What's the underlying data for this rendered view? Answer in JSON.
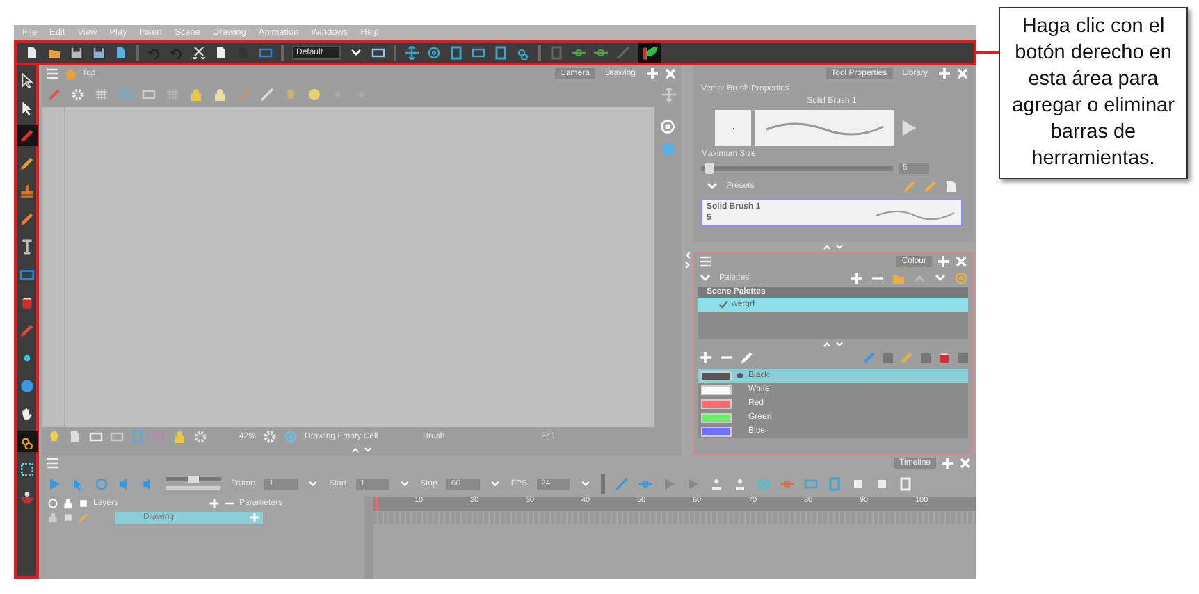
{
  "menu": [
    "File",
    "Edit",
    "View",
    "Play",
    "Insert",
    "Scene",
    "Drawing",
    "Animation",
    "Windows",
    "Help"
  ],
  "toolbar": {
    "preset_dropdown": "Default"
  },
  "tools": [
    {
      "selected": false
    },
    {
      "selected": false
    },
    {
      "selected": true
    },
    {
      "selected": false
    },
    {
      "selected": false
    },
    {
      "selected": false
    },
    {
      "selected": false
    },
    {
      "selected": false
    },
    {
      "selected": false
    },
    {
      "selected": false
    },
    {
      "selected": false
    },
    {
      "selected": false
    },
    {
      "selected": false
    },
    {
      "selected": true
    },
    {
      "selected": false
    },
    {
      "selected": false
    }
  ],
  "camera_view": {
    "breadcrumb": "Top",
    "tabs": [
      {
        "label": "Camera",
        "selected": true
      },
      {
        "label": "Drawing",
        "selected": false
      }
    ],
    "status": {
      "zoom": "42%",
      "cell": "Drawing Empty Cell",
      "tool": "Brush",
      "frame": "Fr 1"
    }
  },
  "tool_properties": {
    "tabs": [
      {
        "label": "Tool Properties",
        "selected": true
      },
      {
        "label": "Library",
        "selected": false
      }
    ],
    "title": "Vector Brush Properties",
    "brush_name": "Solid Brush 1",
    "max_size_label": "Maximum Size",
    "max_size": {
      "level": 0.02,
      "value": "5"
    },
    "presets_label": "Presets",
    "presets": [
      {
        "name": "Solid Brush 1",
        "size": "5",
        "selected": true
      }
    ]
  },
  "colour": {
    "tab": "Colour",
    "palettes_label": "Palettes",
    "palette_list_title": "Scene Palettes",
    "palettes": [
      {
        "name": "wergrf",
        "selected": true,
        "checked": true
      }
    ],
    "colours": [
      {
        "name": "Black",
        "color": "#555555",
        "selected": true
      },
      {
        "name": "White",
        "color": "#ffffff",
        "selected": false
      },
      {
        "name": "Red",
        "color": "#ff6b6b",
        "selected": false
      },
      {
        "name": "Green",
        "color": "#66ee66",
        "selected": false
      },
      {
        "name": "Blue",
        "color": "#7070ff",
        "selected": false
      }
    ]
  },
  "timeline": {
    "tab": "Timeline",
    "speed": {
      "level": 0.5
    },
    "fields": [
      {
        "label": "Frame",
        "value": "1"
      },
      {
        "label": "Start",
        "value": "1"
      },
      {
        "label": "Stop",
        "value": "60"
      },
      {
        "label": "FPS",
        "value": "24"
      }
    ],
    "layers_label": "Layers",
    "parameters_label": "Parameters",
    "ruler": [
      "10",
      "20",
      "30",
      "40",
      "50",
      "60",
      "70",
      "80",
      "90",
      "100"
    ],
    "layers": [
      {
        "name": "Drawing",
        "selected": true
      }
    ]
  },
  "callout": {
    "text": "Haga clic con el botón derecho en esta área para agregar o eliminar barras de herramientas."
  }
}
